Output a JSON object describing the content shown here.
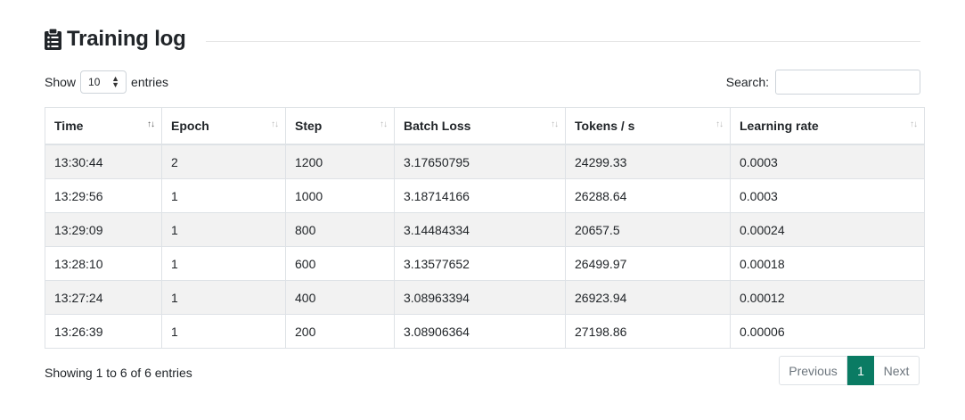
{
  "header": {
    "title": "Training log",
    "icon": "clipboard-list-icon"
  },
  "length": {
    "show_label": "Show",
    "value": "10",
    "entries_label": "entries"
  },
  "search": {
    "label": "Search:",
    "value": ""
  },
  "table": {
    "columns": [
      "Time",
      "Epoch",
      "Step",
      "Batch Loss",
      "Tokens / s",
      "Learning rate"
    ],
    "rows": [
      [
        "13:30:44",
        "2",
        "1200",
        "3.17650795",
        "24299.33",
        "0.0003"
      ],
      [
        "13:29:56",
        "1",
        "1000",
        "3.18714166",
        "26288.64",
        "0.0003"
      ],
      [
        "13:29:09",
        "1",
        "800",
        "3.14484334",
        "20657.5",
        "0.00024"
      ],
      [
        "13:28:10",
        "1",
        "600",
        "3.13577652",
        "26499.97",
        "0.00018"
      ],
      [
        "13:27:24",
        "1",
        "400",
        "3.08963394",
        "26923.94",
        "0.00012"
      ],
      [
        "13:26:39",
        "1",
        "200",
        "3.08906364",
        "27198.86",
        "0.00006"
      ]
    ]
  },
  "footer": {
    "info": "Showing 1 to 6 of 6 entries",
    "previous": "Previous",
    "current_page": "1",
    "next": "Next"
  },
  "colors": {
    "accent": "#0a7b63",
    "stripe": "#f2f2f2"
  }
}
